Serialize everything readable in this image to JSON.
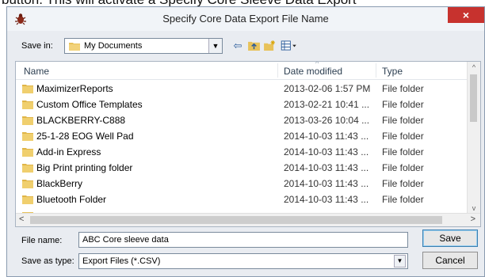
{
  "page": {
    "top_text": "button. This will activate a Specify Core Sleeve Data Export"
  },
  "dialog": {
    "title": "Specify Core Data Export File Name",
    "close_glyph": "×"
  },
  "toolbar": {
    "save_in_label": "Save in:",
    "save_in_value": "My Documents",
    "icons": [
      "back-icon",
      "up-folder-icon",
      "new-folder-icon",
      "view-menu-icon"
    ]
  },
  "list": {
    "columns": {
      "name": "Name",
      "date": "Date modified",
      "type": "Type"
    },
    "rows": [
      {
        "name": "MaximizerReports",
        "date": "2013-02-06 1:57 PM",
        "type": "File folder"
      },
      {
        "name": "Custom Office Templates",
        "date": "2013-02-21 10:41 ...",
        "type": "File folder"
      },
      {
        "name": "BLACKBERRY-C888",
        "date": "2013-03-26 10:04 ...",
        "type": "File folder"
      },
      {
        "name": "25-1-28 EOG Well Pad",
        "date": "2014-10-03 11:43 ...",
        "type": "File folder"
      },
      {
        "name": "Add-in Express",
        "date": "2014-10-03 11:43 ...",
        "type": "File folder"
      },
      {
        "name": "Big Print printing folder",
        "date": "2014-10-03 11:43 ...",
        "type": "File folder"
      },
      {
        "name": "BlackBerry",
        "date": "2014-10-03 11:43 ...",
        "type": "File folder"
      },
      {
        "name": "Bluetooth Folder",
        "date": "2014-10-03 11:43 ...",
        "type": "File folder"
      }
    ]
  },
  "footer": {
    "file_name_label": "File name:",
    "file_name_value": "ABC Core sleeve data",
    "save_as_type_label": "Save as type:",
    "save_as_type_value": "Export Files (*.CSV)",
    "save_button": "Save",
    "cancel_button": "Cancel"
  },
  "colors": {
    "folder": "#e8c25a",
    "close": "#c7322e",
    "accent": "#3c7fb1"
  }
}
